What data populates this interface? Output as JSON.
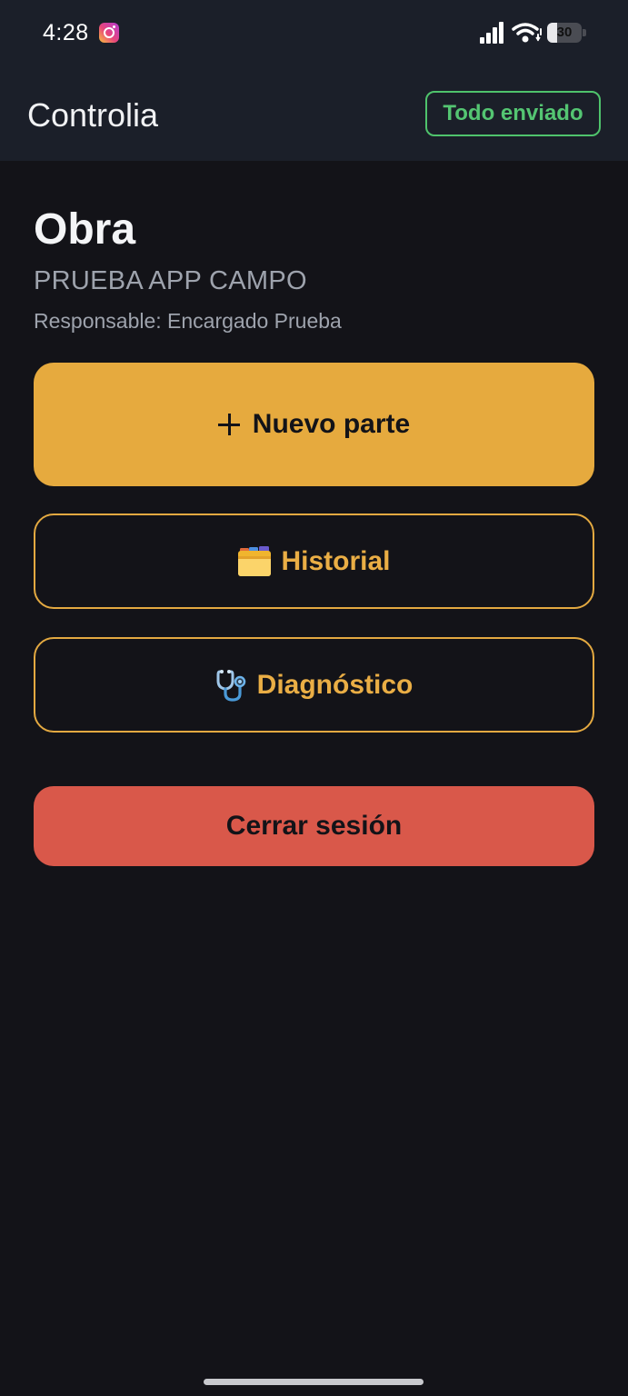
{
  "status_bar": {
    "time": "4:28",
    "battery_level": "30",
    "icons": [
      "instagram-notification-icon",
      "cellular-signal-icon",
      "wifi-icon",
      "battery-icon"
    ]
  },
  "app_bar": {
    "title": "Controlia",
    "sync_status": "Todo enviado"
  },
  "main": {
    "section_title": "Obra",
    "project_name": "PRUEBA APP CAMPO",
    "responsible_line": "Responsable: Encargado Prueba"
  },
  "actions": {
    "new_report": {
      "label": "Nuevo parte",
      "icon": "plus-icon"
    },
    "history": {
      "label": "Historial",
      "icon": "card-index-dividers-icon"
    },
    "diagnostics": {
      "label": "Diagnóstico",
      "icon": "stethoscope-icon"
    },
    "logout": {
      "label": "Cerrar sesión"
    }
  },
  "colors": {
    "background": "#131318",
    "top_bar": "#1b1f29",
    "accent": "#e6aa3e",
    "success": "#4fc36c",
    "danger": "#d9584a",
    "muted_text": "#9ea3ad"
  }
}
